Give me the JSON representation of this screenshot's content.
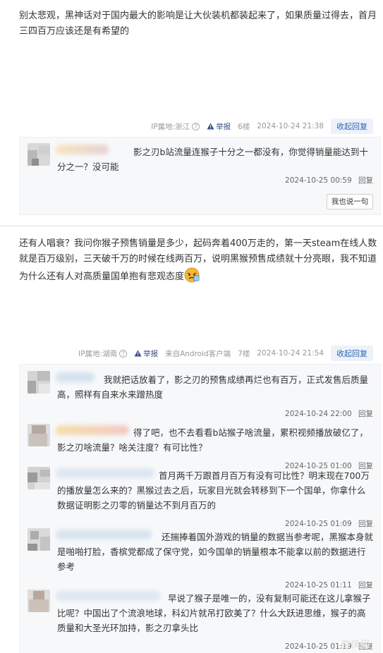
{
  "post1": {
    "text": "别太悲观，黑神话对于国内最大的影响是让大伙装机都装起来了，如果质量过得去，首月三四百万应该还是有希望的",
    "meta": {
      "ip": "IP属地:浙江",
      "report": "举报",
      "floor": "6楼",
      "time": "2024-10-24 21:38",
      "collapse": "收起回复"
    },
    "replies": [
      {
        "text": "影之刃b站流量连猴子十分之一都没有，你觉得销量能达到十分之一？没可能",
        "time": "2024-10-25 00:59",
        "action": "回复"
      }
    ],
    "say_button": "我也说一句"
  },
  "post2": {
    "text": "还有人唱衰？我问你猴子预售销量是多少，起码奔着400万走的，第一天steam在线人数就是百万级别，三天破千万的时候在线两百万，说明黑猴预售成绩就十分亮眼，我不知道为什么还有人对高质量国单抱有悲观态度",
    "meta": {
      "ip": "IP属地:湖南",
      "report": "举报",
      "client": "来自Android客户端",
      "floor": "7楼",
      "time": "2024-10-24 21:54",
      "collapse": "收起回复"
    },
    "replies": [
      {
        "text": "我就把话放着了，影之刃的预售成绩再烂也有百万，正式发售后质量高，照样有自来水来蹭热度",
        "time": "2024-10-24 22:00",
        "action": "回复"
      },
      {
        "text": "得了吧，也不去看看b站猴子啥流量，累积视频播放破亿了，影之刃啥流量？啥关注度？有可比性？",
        "time": "2024-10-25 01:00",
        "action": "回复"
      },
      {
        "text": "首月两千万跟首月百万有没有可比性？明末现在700万的播放量怎么来的？黑猴过去之后，玩家目光就会转移到下一个国单，你拿什么数据证明影之刃零的销量达不到月百万的",
        "time": "2024-10-25 01:09",
        "action": "回复"
      },
      {
        "text": "还揣捧着国外游戏的销量的数据当参考呢，黑猴本身就是啪啪打脸，香槟党都成了保守党，如今国单的销量根本不能拿以前的数据进行参考",
        "time": "2024-10-25 01:11",
        "action": "回复"
      },
      {
        "text": "早说了猴子是唯一的，没有复制可能还在这儿拿猴子比呢？中国出了个流浪地球，科幻片就吊打欧美了？什么大跃进思维，猴子的高质量和大圣光环加持，影之刃拿头比",
        "time": "2024-10-25 01:19",
        "action": "回复"
      }
    ]
  },
  "watermark": "游侠网",
  "colors": {
    "link_blue": "#2d64b3",
    "report_blue": "#3a4e86",
    "reply_bg": "#f7f8fa",
    "meta_gray": "#999999"
  }
}
